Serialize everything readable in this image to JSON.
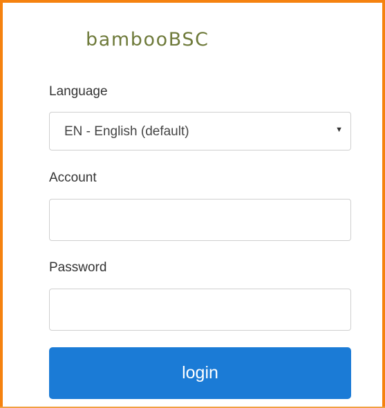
{
  "brand": {
    "logo_text": "bambooBSC",
    "logo_color": "#6e7a3a",
    "frame_color": "#f5820f"
  },
  "form": {
    "language_label": "Language",
    "language_selected": "EN - English (default)",
    "language_caret_icon": "caret-down-icon",
    "account_label": "Account",
    "account_value": "",
    "account_placeholder": "",
    "password_label": "Password",
    "password_value": "",
    "password_placeholder": "",
    "login_label": "login",
    "login_color": "#1b7bd6"
  }
}
